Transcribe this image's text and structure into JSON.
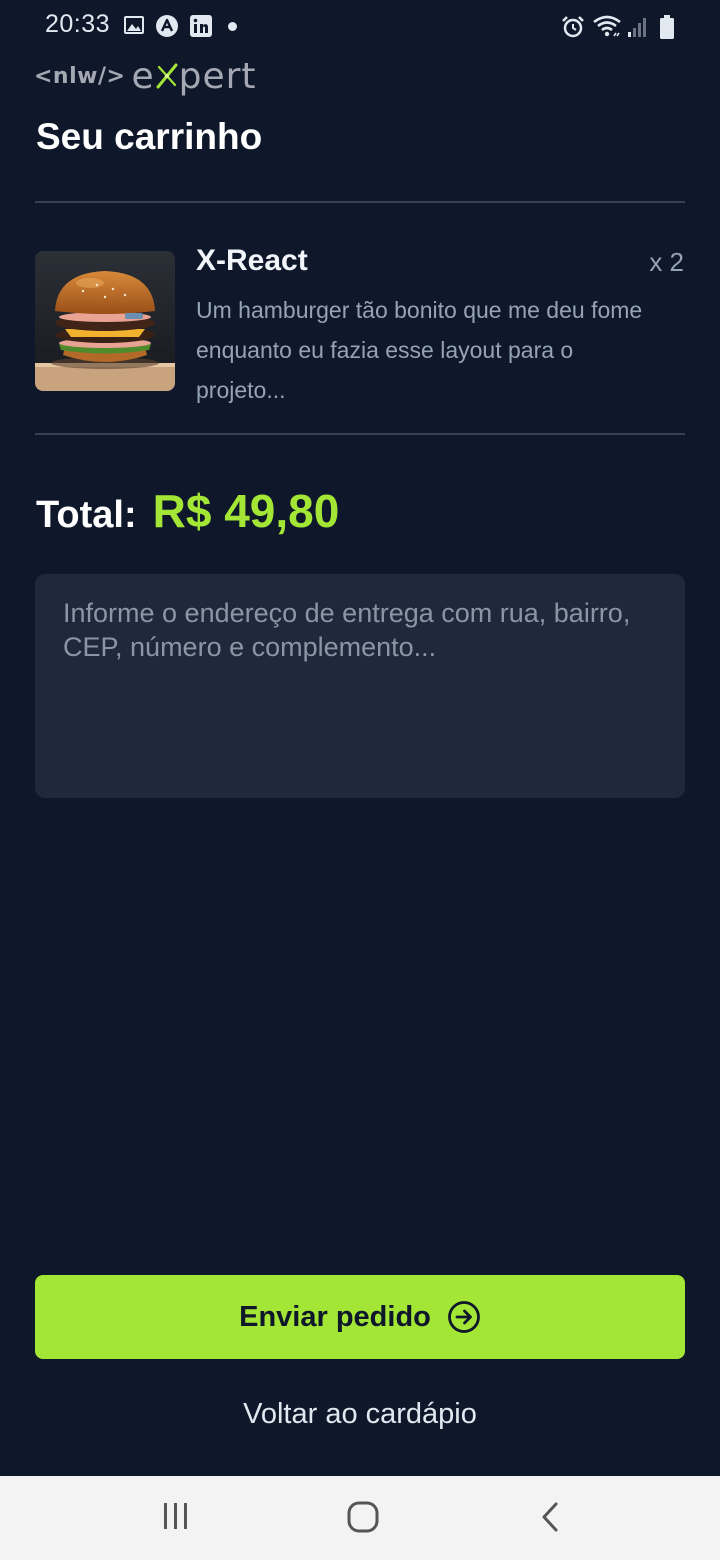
{
  "status_bar": {
    "time": "20:33",
    "left_icons": [
      "gallery-icon",
      "app-a-icon",
      "linkedin-icon",
      "notification-dot-icon"
    ],
    "right_icons": [
      "alarm-icon",
      "wifi-icon",
      "signal-icon",
      "battery-icon"
    ]
  },
  "logo": {
    "prefix": "<nlw/>",
    "suffix_start": "e",
    "suffix_end": "pert"
  },
  "page": {
    "title": "Seu carrinho"
  },
  "cart": {
    "items": [
      {
        "name": "X-React",
        "quantity": "x 2",
        "description": "Um hamburger tão bonito que me deu fome enquanto eu fazia esse layout para o projeto...",
        "image": "burger-image"
      }
    ]
  },
  "total": {
    "label": "Total:",
    "value": "R$ 49,80"
  },
  "address": {
    "value": "",
    "placeholder": "Informe o endereço de entrega com rua, bairro, CEP, número e complemento..."
  },
  "actions": {
    "send_label": "Enviar pedido",
    "back_label": "Voltar ao cardápio"
  },
  "colors": {
    "background": "#0f172a",
    "accent": "#a3e635",
    "field": "#1e293b",
    "divider": "#334155"
  },
  "nav_bar": {
    "buttons": [
      "recents-icon",
      "home-icon",
      "back-icon"
    ]
  }
}
